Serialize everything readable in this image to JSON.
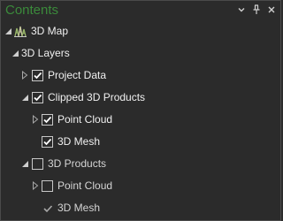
{
  "pane": {
    "title": "Contents",
    "title_color": "#3b8a3b",
    "header_buttons": [
      {
        "icon": "chevron-down-icon"
      },
      {
        "icon": "pin-icon"
      },
      {
        "icon": "close-icon"
      }
    ]
  },
  "tree": {
    "map": {
      "label": "3D Map",
      "icon": "3d-map-icon",
      "expanded": true
    },
    "category": {
      "label": "3D Layers",
      "expanded": true
    },
    "layers": [
      {
        "label": "Project Data",
        "checked": true,
        "expanded": false,
        "has_children": true
      },
      {
        "label": "Clipped 3D Products",
        "checked": true,
        "expanded": true,
        "has_children": true
      },
      {
        "label": "Point Cloud",
        "checked": true,
        "expanded": false,
        "has_children": true
      },
      {
        "label": "3D Mesh",
        "checked": true,
        "expanded": false,
        "has_children": false
      },
      {
        "label": "3D Products",
        "checked": false,
        "expanded": true,
        "has_children": true
      },
      {
        "label": "Point Cloud",
        "checked": false,
        "expanded": false,
        "has_children": true
      },
      {
        "label": "3D Mesh",
        "checked": true,
        "expanded": false,
        "has_children": false
      }
    ]
  }
}
